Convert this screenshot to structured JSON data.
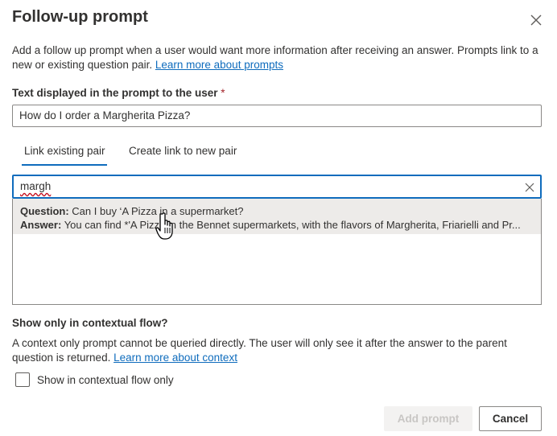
{
  "dialog": {
    "title": "Follow-up prompt",
    "description": "Add a follow up prompt when a user would want more information after receiving an answer. Prompts link to a new or existing question pair.",
    "learn_more_prompts": "Learn more about prompts",
    "close_icon": "close-icon"
  },
  "prompt_field": {
    "label": "Text displayed in the prompt to the user",
    "required_marker": "*",
    "value": "How do I order a Margherita Pizza?"
  },
  "tabs": [
    {
      "label": "Link existing pair",
      "active": true
    },
    {
      "label": "Create link to new pair",
      "active": false
    }
  ],
  "search": {
    "value": "margh",
    "clear_icon": "clear-icon"
  },
  "results": [
    {
      "question_label": "Question:",
      "question_text": "Can I buy ‘A Pizza in a supermarket?",
      "answer_label": "Answer:",
      "answer_text": "You can find *'A Pizza in the Bennet supermarkets, with the flavors of Margherita, Friarielli and Pr..."
    }
  ],
  "contextual": {
    "title": "Show only in contextual flow?",
    "description": "A context only prompt cannot be queried directly. The user will only see it after the answer to the parent question is returned.",
    "learn_more_context": "Learn more about context",
    "checkbox_label": "Show in contextual flow only",
    "checked": false
  },
  "footer": {
    "add_label": "Add prompt",
    "add_disabled": true,
    "cancel_label": "Cancel"
  },
  "colors": {
    "accent": "#0f6cbd",
    "required": "#a4262c",
    "hover_row": "#edebe9",
    "disabled_text": "#c8c6c4"
  }
}
